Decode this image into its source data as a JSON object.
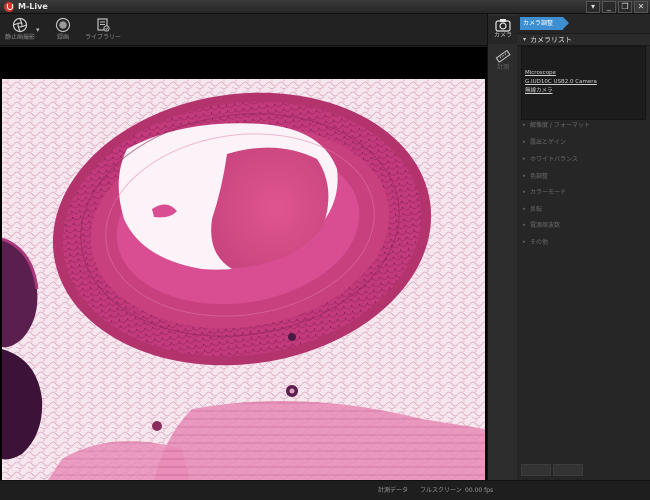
{
  "window": {
    "title": "M-Live",
    "controls": {
      "menu": "▾",
      "minimize": "_",
      "restore": "❐",
      "close": "✕"
    }
  },
  "toolbar": {
    "still_label": "静止画撮影",
    "record_label": "録画",
    "library_label": "ライブラリー"
  },
  "strip": {
    "camera_label": "カメラ",
    "measure_label": "計測"
  },
  "panel": {
    "tab_label": "カメラ調整",
    "header": "カメラリスト",
    "cameras": [
      "Microscope",
      "G.IUD10C USB2.0 Camera",
      "無線カメラ"
    ],
    "sections": [
      "解像度 / フォーマット",
      "露出とゲイン",
      "ホワイトバランス",
      "色調整",
      "カラーモード",
      "反転",
      "電源周波数",
      "その他"
    ],
    "buttons": [
      "",
      ""
    ]
  },
  "status": {
    "measure": "計測データ",
    "fullscreen": "フルスクリーン",
    "fps": "00.00 fps"
  },
  "colors": {
    "accent": "#3d8fd1",
    "tissue_pink": "#d94e92",
    "tissue_dark": "#b3336d",
    "background": "#1b1b1b"
  }
}
